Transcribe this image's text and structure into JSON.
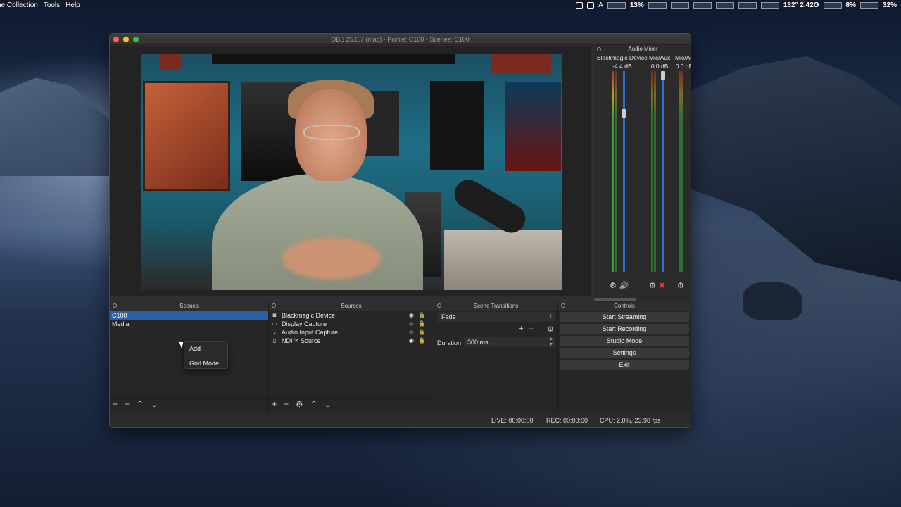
{
  "menubar": {
    "items": [
      "ne Collection",
      "Tools",
      "Help"
    ],
    "status": {
      "cpu_percent": "13%",
      "temp_freq": "132° 2.42G",
      "battery_a": "8%",
      "battery_b": "32%",
      "letter": "A"
    }
  },
  "window": {
    "title": "OBS 25.0.7 (mac) - Profile: C100 - Scenes: C100"
  },
  "audio_mixer": {
    "title": "Audio Mixer",
    "channels": [
      {
        "name": "Blackmagic Device",
        "db": "-4.4 dB",
        "level": 0.78
      },
      {
        "name": "Mic/Aux",
        "db": "0.0 dB",
        "level": 0.98
      },
      {
        "name": "Mic/Au",
        "db": "0.0 dB",
        "level": 0.98
      }
    ]
  },
  "scenes": {
    "title": "Scenes",
    "items": [
      "C100",
      "Media"
    ],
    "selected": "C100"
  },
  "sources": {
    "title": "Sources",
    "items": [
      {
        "label": "Blackmagic Device",
        "icon": "camera-icon",
        "visible": true,
        "locked": true
      },
      {
        "label": "Display Capture",
        "icon": "monitor-icon",
        "visible": false,
        "locked": false
      },
      {
        "label": "Audio Input Capture",
        "icon": "microphone-icon",
        "visible": false,
        "locked": true
      },
      {
        "label": "NDI™ Source",
        "icon": "document-icon",
        "visible": true,
        "locked": true
      }
    ]
  },
  "transitions": {
    "title": "Scene Transitions",
    "selected": "Fade",
    "duration_label": "Duration",
    "duration_value": "300 ms"
  },
  "controls": {
    "title": "Controls",
    "buttons": [
      "Start Streaming",
      "Start Recording",
      "Studio Mode",
      "Settings",
      "Exit"
    ]
  },
  "context_menu": {
    "items": [
      "Add",
      "Grid Mode"
    ]
  },
  "statusbar": {
    "live": "LIVE: 00:00:00",
    "rec": "REC: 00:00:00",
    "cpu": "CPU: 2.0%, 23.98 fps"
  },
  "colors": {
    "selection": "#2d5fa8",
    "meter_green": "#37a338",
    "fader_blue": "#2d6fc9"
  }
}
